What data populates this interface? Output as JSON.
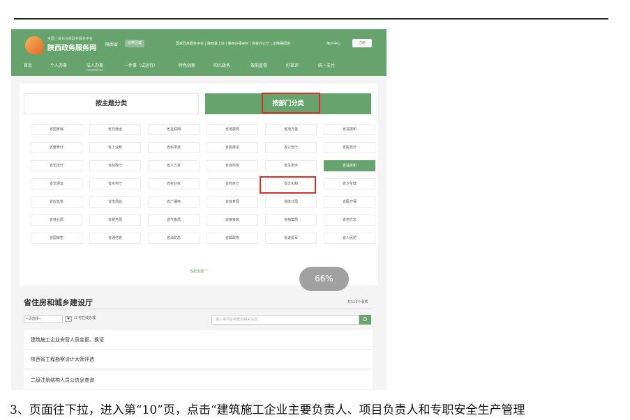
{
  "site": {
    "tagline": "全国一体化在线政务服务平台",
    "name": "陕西政务服务网",
    "region": "陕西省",
    "region_switch": "切换区域",
    "top_links": "国家政务服务平台 | 陕西掌上办 | 陕西办事APP | 省委办公厅 | 无障碍阅读",
    "user_center": "用户中心",
    "register": "注册"
  },
  "nav": [
    "首页",
    "个人办事",
    "法人办事",
    "一件事（试运行）",
    "特色创新",
    "阳光政务",
    "效能监督",
    "好差评",
    "统一支付"
  ],
  "panel": {
    "tab_theme": "按主题分类",
    "tab_dept": "按部门分类",
    "collapse_all": "收起全部 ^",
    "zoom": "66%"
  },
  "departments": [
    "省国家保",
    "省交通运",
    "省互联网",
    "省地震局",
    "省地方金",
    "省发展和",
    "省教育厅",
    "省工业和",
    "省科学技",
    "省民族宗",
    "省公安厅",
    "省民政厅",
    "省司法厅",
    "省财政厅",
    "省人力资",
    "省自然资",
    "省生态环",
    "省住房和",
    "省交通运",
    "省水利厅",
    "省农业农",
    "省商务厅",
    "省文化和",
    "省卫生健",
    "省应急管",
    "省市场监",
    "省广播电",
    "省体育局",
    "省统计局",
    "省医疗保",
    "省林业局",
    "省税务局",
    "省气象局",
    "省粮食和",
    "省档案局",
    "省地方志",
    "省国家密",
    "省通信管",
    "省消防总",
    "省邮政管",
    "省退役军",
    "省人民防"
  ],
  "active_department": "省住房和",
  "list": {
    "title": "省住房和城乡建设厅",
    "count": "共112个事项",
    "select_placeholder": "--请选择--",
    "online_label": "可在线办理",
    "search_placeholder": "输入事项名称查询相关信息",
    "items": [
      "建筑施工企业安管人员变更、换证",
      "陕西省工程勘察设计大师评选",
      "二级注册结构人员公信息查询"
    ]
  },
  "caption": "3、页面往下拉，进入第“10”页，点击“建筑施工企业主要负责人、项目负责人和专职安全生产管理"
}
